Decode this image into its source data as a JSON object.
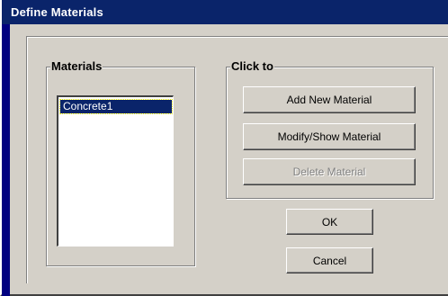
{
  "window": {
    "title": "Define Materials"
  },
  "materials": {
    "group_label": "Materials",
    "items": [
      "Concrete1"
    ],
    "selected": "Concrete1"
  },
  "click_to": {
    "group_label": "Click to",
    "add_label": "Add New Material",
    "modify_label": "Modify/Show Material",
    "delete_label": "Delete Material"
  },
  "buttons": {
    "ok_label": "OK",
    "cancel_label": "Cancel"
  },
  "colors": {
    "titlebar": "#0a246a",
    "face": "#d4d0c8",
    "selection": "#0a246a",
    "disabled_text": "#808080"
  }
}
